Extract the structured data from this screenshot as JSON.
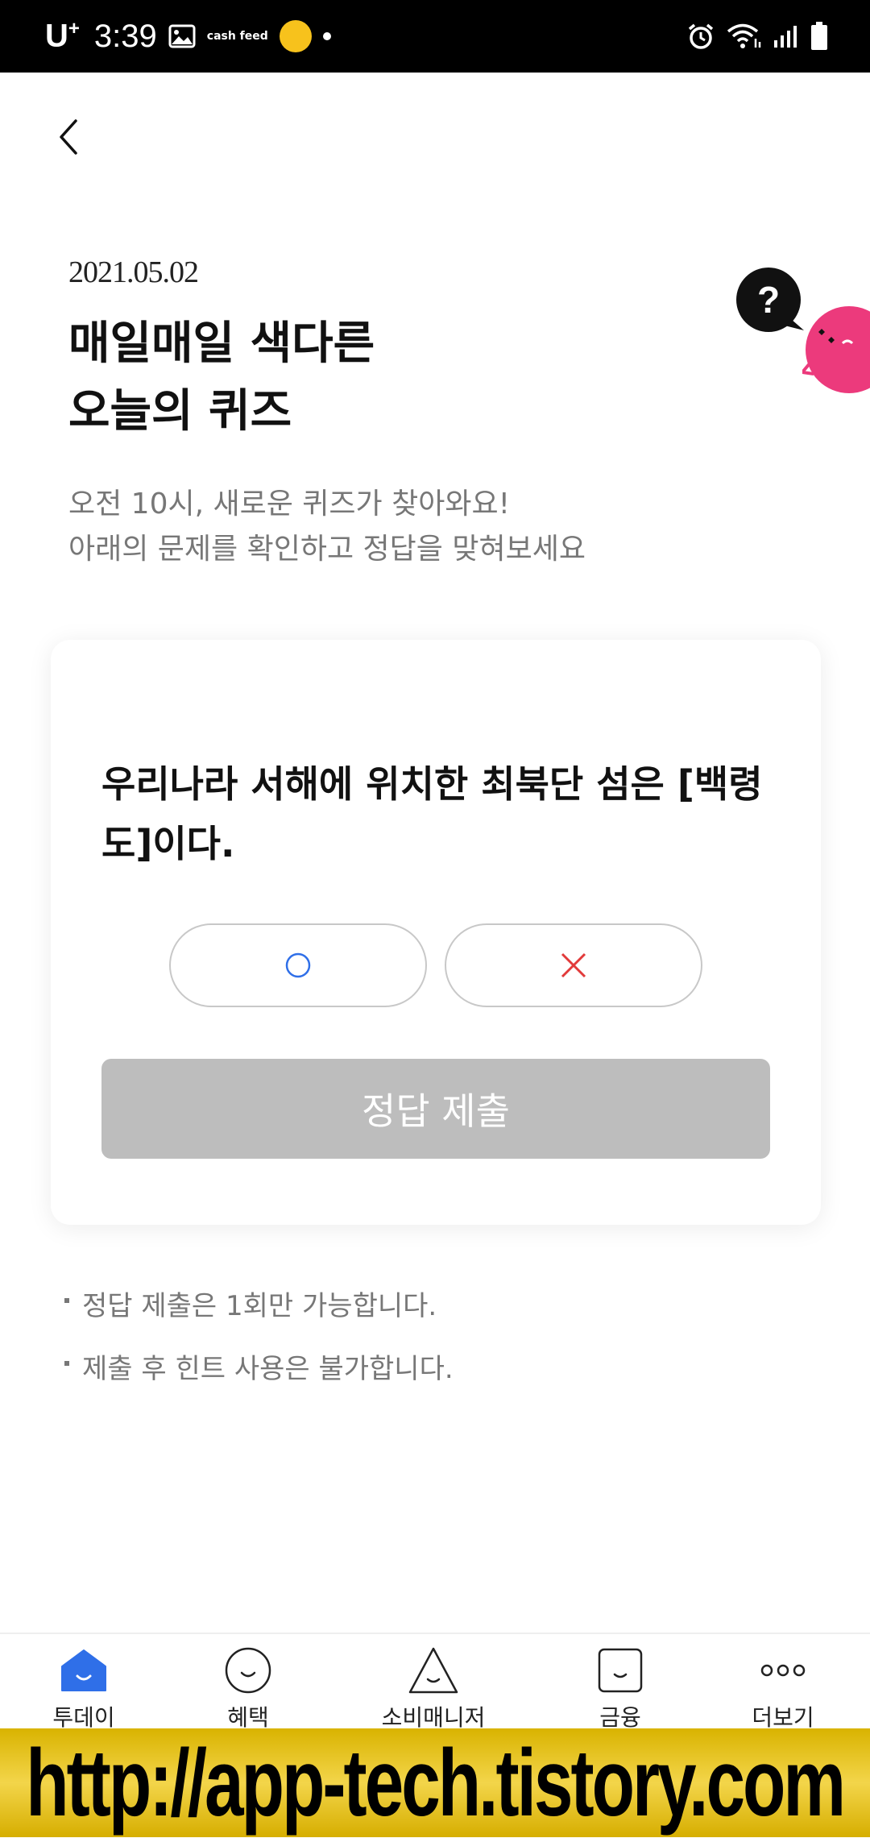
{
  "status_bar": {
    "carrier": "U",
    "carrier_sup": "+",
    "time": "3:39",
    "cashfeed_label": "cash feed"
  },
  "header": {
    "back_icon": "chevron-left-icon"
  },
  "quiz_intro": {
    "date": "2021.05.02",
    "title_line1": "매일매일 색다른",
    "title_line2": "오늘의 퀴즈",
    "desc_line1": "오전 10시, 새로운 퀴즈가 찾아와요!",
    "desc_line2": "아래의 문제를 확인하고 정답을 맞혀보세요"
  },
  "quiz_card": {
    "question": "우리나라 서해에 위치한 최북단 섬은 [백령도]이다.",
    "answer_o_symbol": "circle-o",
    "answer_x_symbol": "cross-x",
    "submit_label": "정답 제출"
  },
  "notes": [
    "정답 제출은 1회만 가능합니다.",
    "제출 후 힌트 사용은 불가합니다."
  ],
  "tabbar": {
    "items": [
      {
        "label": "투데이",
        "icon": "home-smile-icon",
        "active": true
      },
      {
        "label": "혜택",
        "icon": "circle-smile-icon",
        "active": false
      },
      {
        "label": "소비매니저",
        "icon": "triangle-smile-icon",
        "active": false
      },
      {
        "label": "금융",
        "icon": "square-smile-icon",
        "active": false
      },
      {
        "label": "더보기",
        "icon": "more-dots-icon",
        "active": false
      }
    ]
  },
  "watermark": {
    "text": "http://app-tech.tistory.com"
  },
  "colors": {
    "accent_blue": "#2f6fe8",
    "x_red": "#e23a3a",
    "o_blue": "#2f6fe8",
    "submit_disabled": "#bdbdbd",
    "pink_character": "#ec3a7c",
    "watermark_bg": "#e5c02a"
  }
}
